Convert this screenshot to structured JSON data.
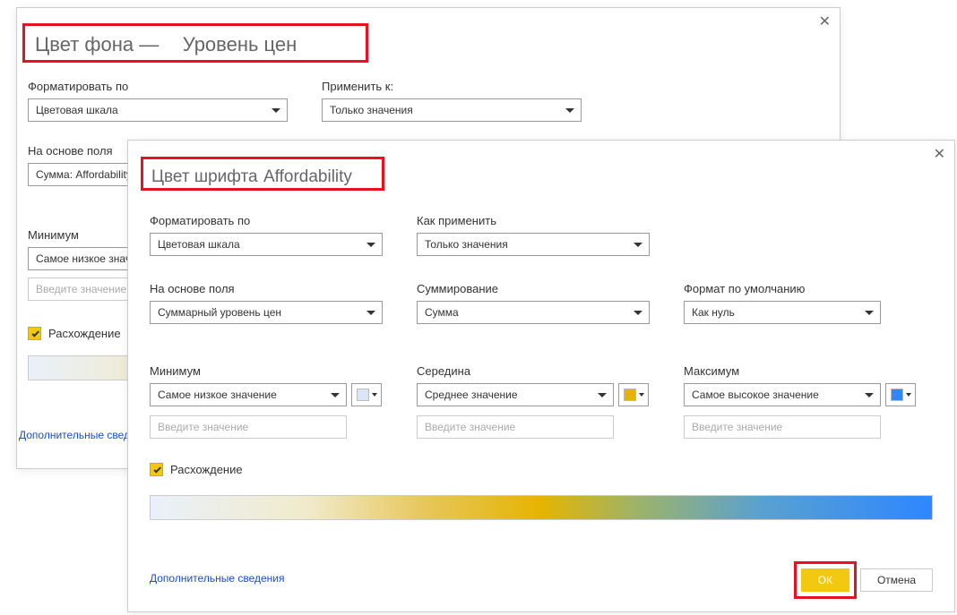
{
  "dialog1": {
    "title_prefix": "Цвет фона —",
    "title_suffix": "Уровень цен",
    "format_by_label": "Форматировать по",
    "format_by_value": "Цветовая шкала",
    "apply_to_label": "Применить к:",
    "apply_to_value": "Только значения",
    "based_on_field_label": "На основе поля",
    "based_on_field_value": "Сумма: Affordability",
    "minimum_label": "Минимум",
    "min_select": "Самое низкое значение",
    "value_placeholder": "Введите значение",
    "diverging_label": "Расхождение",
    "more_info": "Дополнительные сведения"
  },
  "dialog2": {
    "title_prefix": "Цвет шрифта",
    "title_ital": "Affordability",
    "format_by_label": "Форматировать по",
    "format_by_value": "Цветовая шкала",
    "apply_label": "Как применить",
    "apply_value": "Только значения",
    "based_on_field_label": "На основе поля",
    "based_on_field_value": "Суммарный уровень цен",
    "summarization_label": "Суммирование",
    "summarization_value": "Сумма",
    "default_format_label": "Формат по умолчанию",
    "default_format_value": "Как нуль",
    "minimum_label": "Минимум",
    "min_select": "Самое низкое значение",
    "min_color": "#dbe6f4",
    "center_label": "Середина",
    "center_select": "Среднее значение",
    "center_color": "#e6b400",
    "maximum_label": "Максимум",
    "max_select": "Самое высокое значение",
    "max_color": "#2e87ff",
    "value_placeholder": "Введите значение",
    "diverging_label": "Расхождение",
    "ok_label": "ОК",
    "cancel_label": "Отмена",
    "more_info": "Дополнительные сведения"
  },
  "gradient_css": "linear-gradient(to right, #e9f0fa 0%, #f1ebcc 20%, #e7c65c 35%, #e6b400 50%, #9fb367 62%, #5aa1d0 78%, #2e87ff 100%)"
}
